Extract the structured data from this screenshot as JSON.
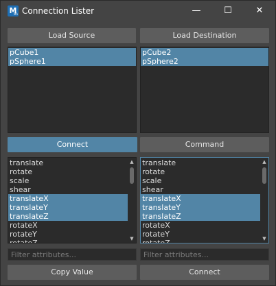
{
  "window": {
    "title": "Connection Lister",
    "icon_letter": "M",
    "icon_sub": "MA"
  },
  "window_controls": {
    "minimize": "—",
    "maximize": "☐",
    "close": "✕"
  },
  "top_buttons": {
    "load_source": "Load Source",
    "load_destination": "Load Destination"
  },
  "source_nodes": [
    {
      "label": "pCube1",
      "selected": true
    },
    {
      "label": "pSphere1",
      "selected": true
    }
  ],
  "destination_nodes": [
    {
      "label": "pCube2",
      "selected": true
    },
    {
      "label": "pSphere2",
      "selected": true
    }
  ],
  "mode_tabs": {
    "connect": "Connect",
    "command": "Command",
    "active": "connect"
  },
  "source_attributes": [
    {
      "label": "translate",
      "selected": false
    },
    {
      "label": "rotate",
      "selected": false
    },
    {
      "label": "scale",
      "selected": false
    },
    {
      "label": "shear",
      "selected": false
    },
    {
      "label": "translateX",
      "selected": true
    },
    {
      "label": "translateY",
      "selected": true
    },
    {
      "label": "translateZ",
      "selected": true
    },
    {
      "label": "rotateX",
      "selected": false
    },
    {
      "label": "rotateY",
      "selected": false
    },
    {
      "label": "rotateZ",
      "selected": false
    }
  ],
  "destination_attributes": [
    {
      "label": "translate",
      "selected": false
    },
    {
      "label": "rotate",
      "selected": false
    },
    {
      "label": "scale",
      "selected": false
    },
    {
      "label": "shear",
      "selected": false
    },
    {
      "label": "translateX",
      "selected": true
    },
    {
      "label": "translateY",
      "selected": true
    },
    {
      "label": "translateZ",
      "selected": true
    },
    {
      "label": "rotateX",
      "selected": false
    },
    {
      "label": "rotateY",
      "selected": false
    },
    {
      "label": "rotateZ",
      "selected": false
    }
  ],
  "filters": {
    "source_placeholder": "Filter attributes...",
    "destination_placeholder": "Filter attributes..."
  },
  "bottom_buttons": {
    "copy_value": "Copy Value",
    "connect": "Connect"
  },
  "colors": {
    "background": "#444444",
    "button": "#5d5d5d",
    "selection": "#5285a6",
    "list_bg": "#2b2b2b"
  }
}
